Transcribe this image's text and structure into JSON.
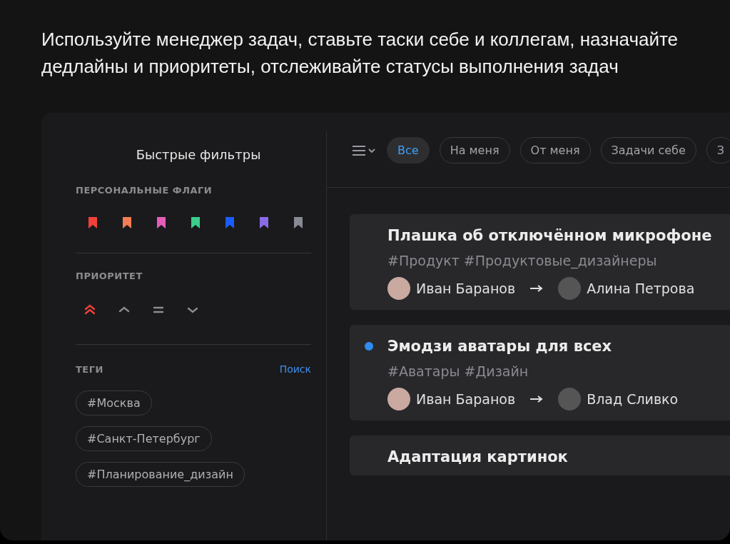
{
  "headline": "Используйте менеджер задач, ставьте таски себе и коллегам, назначайте дедлайны и приоритеты, отслеживайте статусы выполнения задач",
  "sidebar": {
    "title": "Быстрые фильтры",
    "flags_heading": "ПЕРСОНАЛЬНЫЕ ФЛАГИ",
    "flags": [
      {
        "color": "#f2403a"
      },
      {
        "color": "#f57d55"
      },
      {
        "color": "#e45cb9"
      },
      {
        "color": "#3ccd8c"
      },
      {
        "color": "#1a5cff"
      },
      {
        "color": "#8a6be6"
      },
      {
        "color": "#878a94"
      }
    ],
    "priority_heading": "ПРИОРИТЕТ",
    "priorities": [
      {
        "kind": "highest",
        "selected": true
      },
      {
        "kind": "high",
        "selected": false
      },
      {
        "kind": "medium",
        "selected": false
      },
      {
        "kind": "low",
        "selected": false
      }
    ],
    "tags_heading": "ТЕГИ",
    "tags_search": "Поиск",
    "tags": [
      "#Москва",
      "#Санкт-Петербург",
      "#Планирование_дизайн"
    ]
  },
  "filters": [
    {
      "label": "Все",
      "selected": true
    },
    {
      "label": "На меня",
      "selected": false
    },
    {
      "label": "От меня",
      "selected": false
    },
    {
      "label": "Задачи себе",
      "selected": false
    },
    {
      "label": "З",
      "selected": false
    }
  ],
  "tasks": [
    {
      "title": "Плашка об отключённом микрофоне",
      "unread": false,
      "tags": "#Продукт #Продуктовые_дизайнеры",
      "from": "Иван Баранов",
      "to": "Алина Петрова"
    },
    {
      "title": "Эмодзи аватары для всех",
      "unread": true,
      "tags": "#Аватары #Дизайн",
      "from": "Иван Баранов",
      "to": "Влад Сливко"
    },
    {
      "title": "Адаптация картинок",
      "unread": false
    }
  ]
}
